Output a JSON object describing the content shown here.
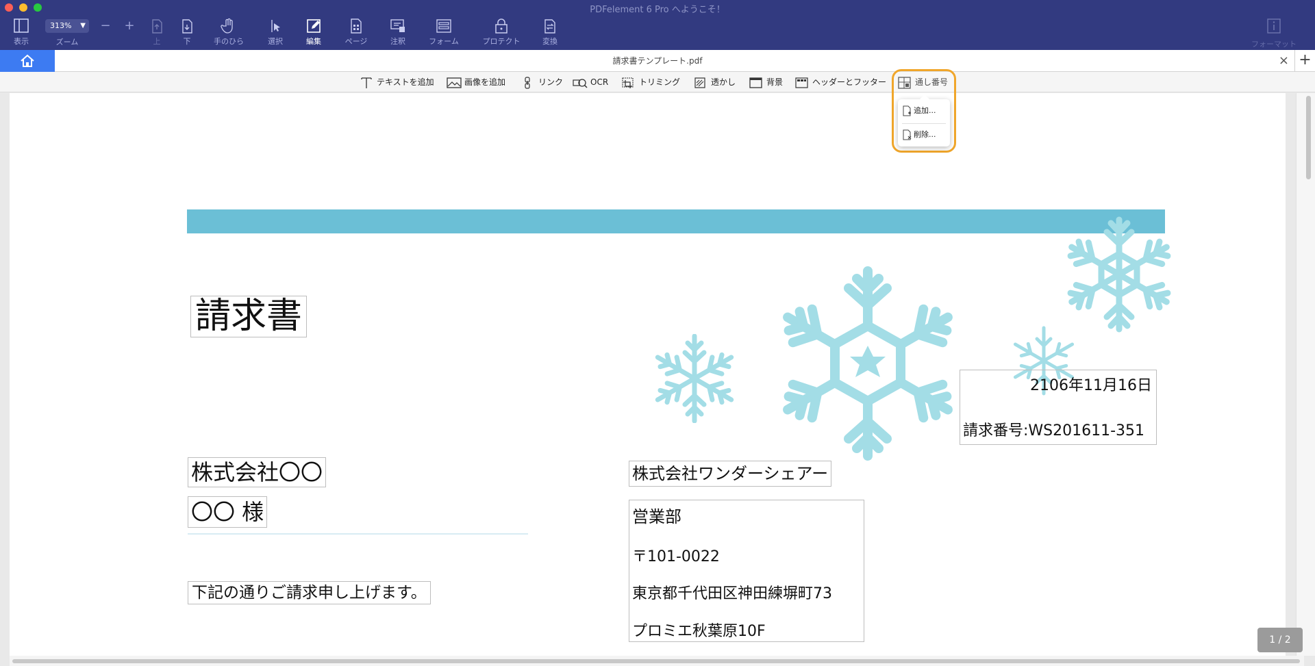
{
  "window": {
    "title": "PDFelement 6 Pro へようこそ！"
  },
  "toolbar": {
    "view_label": "表示",
    "zoom_value": "313%",
    "zoom_label": "ズーム",
    "zoom_minus": "−",
    "zoom_plus": "+",
    "up_label": "上",
    "down_label": "下",
    "hand_label": "手のひら",
    "select_label": "選択",
    "edit_label": "編集",
    "page_label": "ページ",
    "comment_label": "注釈",
    "form_label": "フォーム",
    "protect_label": "プロテクト",
    "convert_label": "変換",
    "format_label": "フォーマット"
  },
  "tabs": {
    "document_title": "請求書テンプレート.pdf",
    "close": "×",
    "add": "+"
  },
  "edit_toolbar": {
    "add_text": "テキストを追加",
    "add_image": "画像を追加",
    "link": "リンク",
    "ocr": "OCR",
    "crop": "トリミング",
    "watermark": "透かし",
    "background": "背景",
    "header_footer": "ヘッダーとフッター",
    "bates": "通し番号"
  },
  "bates_menu": {
    "add": "追加...",
    "remove": "削除..."
  },
  "document": {
    "title": "請求書",
    "date": "2106年11月16日",
    "invoice_number": "請求番号:WS201611-351",
    "client_company": "株式会社〇〇",
    "client_name": "〇〇 様",
    "message": "下記の通りご請求申し上げます。",
    "sender_company": "株式会社ワンダーシェアー",
    "sender_dept": "営業部",
    "sender_postal": "〒101-0022",
    "sender_address1": "東京都千代田区神田練塀町73",
    "sender_address2": "プロミエ秋葉原10F"
  },
  "page_indicator": "1 / 2",
  "colors": {
    "toolbar_bg": "#323a80",
    "accent": "#3d7bf2",
    "banner": "#6bbfd6",
    "snowflake": "#a3dde6",
    "highlight": "#f0a62b"
  }
}
